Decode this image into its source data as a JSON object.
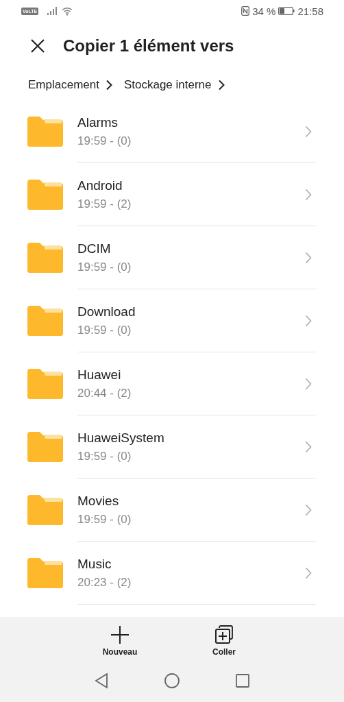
{
  "status_bar": {
    "network_badge": "VoLTE",
    "battery": "34 %",
    "time": "21:58"
  },
  "header": {
    "title": "Copier 1 élément vers"
  },
  "breadcrumb": [
    "Emplacement",
    "Stockage interne"
  ],
  "folders": [
    {
      "name": "Alarms",
      "details": "19:59 - (0)"
    },
    {
      "name": "Android",
      "details": "19:59 - (2)"
    },
    {
      "name": "DCIM",
      "details": "19:59 - (0)"
    },
    {
      "name": "Download",
      "details": "19:59 - (0)"
    },
    {
      "name": "Huawei",
      "details": "20:44 - (2)"
    },
    {
      "name": "HuaweiSystem",
      "details": "19:59 - (0)"
    },
    {
      "name": "Movies",
      "details": "19:59 - (0)"
    },
    {
      "name": "Music",
      "details": "20:23 - (2)"
    }
  ],
  "actions": [
    {
      "kind": "new",
      "label": "Nouveau"
    },
    {
      "kind": "paste",
      "label": "Coller"
    }
  ]
}
